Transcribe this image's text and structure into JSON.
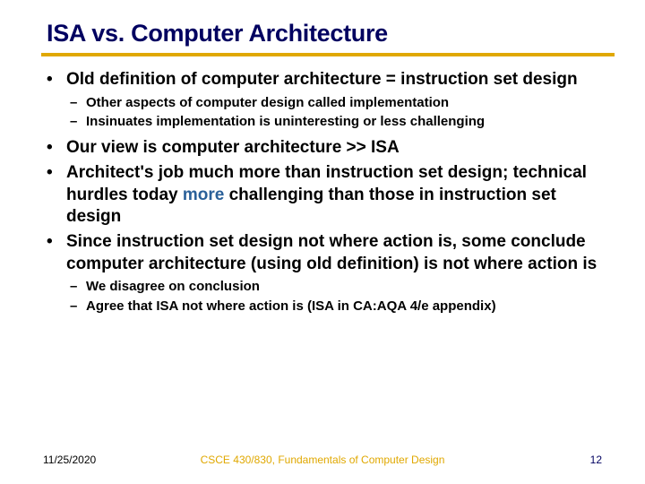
{
  "title": "ISA vs. Computer Architecture",
  "bullets": {
    "b1": "Old definition of computer architecture = instruction set design",
    "b1a": "Other aspects of computer design called implementation",
    "b1b": "Insinuates implementation is uninteresting or less challenging",
    "b2": "Our view is computer architecture >> ISA",
    "b3a": "Architect's job much more than instruction set design; technical hurdles today ",
    "b3more": "more",
    "b3b": " challenging than those in instruction set design",
    "b4": "Since instruction set design not where action is, some conclude computer architecture (using old definition) is not where action is",
    "b4a": "We disagree on conclusion",
    "b4b": "Agree that ISA not where action is (ISA in CA:AQA 4/e appendix)"
  },
  "footer": {
    "date": "11/25/2020",
    "course": "CSCE 430/830, Fundamentals of Computer Design",
    "page": "12"
  },
  "glyphs": {
    "dot": "•",
    "dash": "–"
  }
}
